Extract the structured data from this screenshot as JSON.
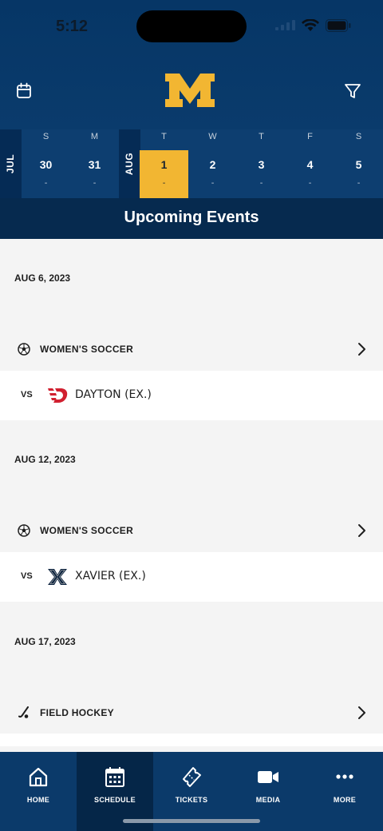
{
  "status_bar": {
    "time": "5:12"
  },
  "header": {
    "logo_text": "M",
    "colors": {
      "primary": "#0a3b6c",
      "accent": "#f2b632"
    }
  },
  "calendar": {
    "months": [
      "JUL",
      "AUG"
    ],
    "days": [
      {
        "dow": "S",
        "num": "30",
        "dot": "-"
      },
      {
        "dow": "M",
        "num": "31",
        "dot": "-"
      },
      {
        "dow": "T",
        "num": "1",
        "dot": "-"
      },
      {
        "dow": "W",
        "num": "2",
        "dot": "-"
      },
      {
        "dow": "T",
        "num": "3",
        "dot": "-"
      },
      {
        "dow": "F",
        "num": "4",
        "dot": "-"
      },
      {
        "dow": "S",
        "num": "5",
        "dot": "-"
      }
    ],
    "selected_day": "1"
  },
  "section_title": "Upcoming Events",
  "events": [
    {
      "date": "AUG 6, 2023",
      "sport": "WOMEN'S SOCCER",
      "sport_icon": "soccer-ball-icon",
      "vs": "VS",
      "opponent": "DAYTON (EX.)"
    },
    {
      "date": "AUG 12, 2023",
      "sport": "WOMEN'S SOCCER",
      "sport_icon": "soccer-ball-icon",
      "vs": "VS",
      "opponent": "XAVIER (EX.)"
    },
    {
      "date": "AUG 17, 2023",
      "sport": "FIELD HOCKEY",
      "sport_icon": "field-hockey-icon"
    }
  ],
  "tabs": [
    {
      "label": "HOME",
      "icon": "home-icon"
    },
    {
      "label": "SCHEDULE",
      "icon": "calendar-icon",
      "active": true
    },
    {
      "label": "TICKETS",
      "icon": "ticket-icon"
    },
    {
      "label": "MEDIA",
      "icon": "video-camera-icon"
    },
    {
      "label": "MORE",
      "icon": "more-dots-icon"
    }
  ]
}
